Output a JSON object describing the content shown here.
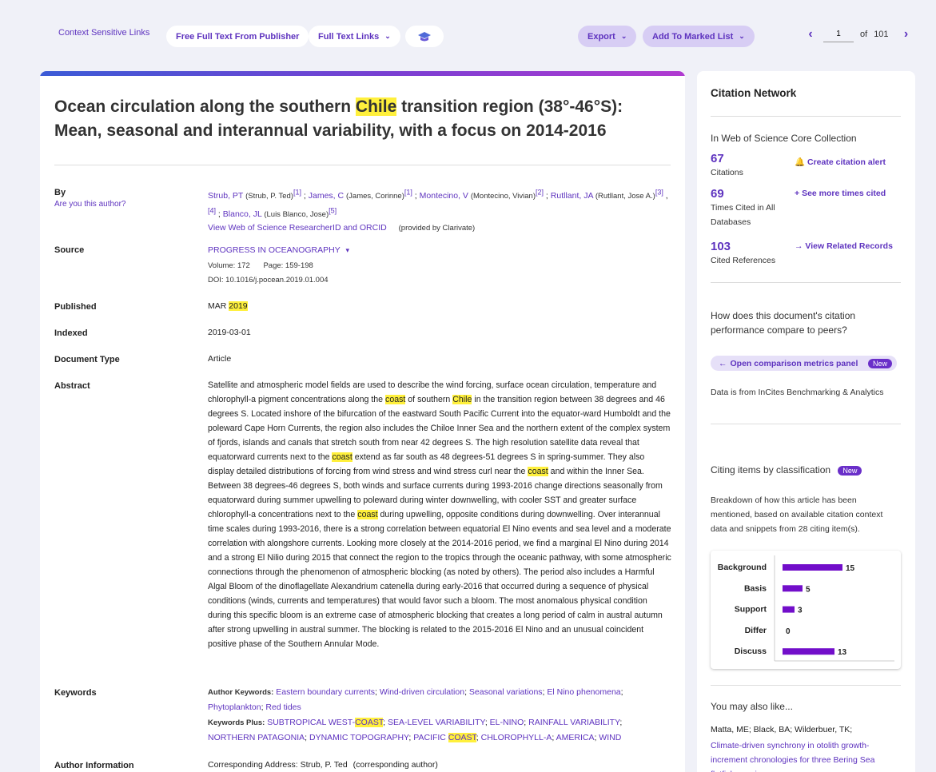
{
  "toolbar": {
    "context_links": "Context Sensitive Links",
    "free_full_text": "Free Full Text From Publisher",
    "full_text_links": "Full Text Links",
    "export": "Export",
    "add_marked": "Add To Marked List",
    "page_current": "1",
    "page_of": "of",
    "page_total": "101"
  },
  "record": {
    "title_pre": "Ocean circulation along the southern ",
    "title_hl": "Chile",
    "title_post": " transition region (38°-46°S): Mean, seasonal and interannual variability, with a focus on 2014-2016",
    "by_label": "By",
    "are_you": "Are you this author?",
    "authors": [
      {
        "name": "Strub, PT",
        "full": "(Strub, P. Ted)",
        "refs": [
          "[1]"
        ]
      },
      {
        "name": "James, C",
        "full": "(James, Corinne)",
        "refs": [
          "[1]"
        ]
      },
      {
        "name": "Montecino, V",
        "full": "(Montecino, Vivian)",
        "refs": [
          "[2]"
        ]
      },
      {
        "name": "Rutllant, JA",
        "full": "(Rutllant, Jose A.)",
        "refs": [
          "[3]",
          "[4]"
        ]
      },
      {
        "name": "Blanco, JL",
        "full": "(Luis Blanco, Jose)",
        "refs": [
          "[5]"
        ]
      }
    ],
    "researcher_link": "View Web of Science ResearcherID and ORCID",
    "provided_by": "(provided by Clarivate)",
    "source_label": "Source",
    "source": "PROGRESS IN OCEANOGRAPHY",
    "volume": "Volume: 172",
    "pages": "Page: 159-198",
    "doi": "DOI: 10.1016/j.pocean.2019.01.004",
    "published_label": "Published",
    "published_month": "MAR",
    "published_year": "2019",
    "indexed_label": "Indexed",
    "indexed": "2019-03-01",
    "doctype_label": "Document Type",
    "doctype": "Article",
    "abstract_label": "Abstract",
    "abstract": [
      {
        "t": "Satellite and atmospheric model fields are used to describe the wind forcing, surface ocean circulation, temperature and chlorophyll-a pigment concentrations along the "
      },
      {
        "t": "coast",
        "h": true
      },
      {
        "t": " of southern "
      },
      {
        "t": "Chile",
        "h": true
      },
      {
        "t": " in the transition region between 38 degrees and 46 degrees S. Located inshore of the bifurcation of the eastward South Pacific Current into the equator-ward Humboldt and the poleward Cape Horn Currents, the region also includes the Chiloe Inner Sea and the northern extent of the complex system of fjords, islands and canals that stretch south from near 42 degrees S. The high resolution satellite data reveal that equatorward currents next to the "
      },
      {
        "t": "coast",
        "h": true
      },
      {
        "t": " extend as far south as 48 degrees-51 degrees S in spring-summer. They also display detailed distributions of forcing from wind stress and wind stress curl near the "
      },
      {
        "t": "coast",
        "h": true
      },
      {
        "t": " and within the Inner Sea. Between 38 degrees-46 degrees S, both winds and surface currents during 1993-2016 change directions seasonally from equatorward during summer upwelling to poleward during winter downwelling, with cooler SST and greater surface chlorophyll-a concentrations next to the "
      },
      {
        "t": "coast",
        "h": true
      },
      {
        "t": " during upwelling, opposite conditions during downwelling. Over interannual time scales during 1993-2016, there is a strong correlation between equatorial El Nino events and sea level and a moderate correlation with alongshore currents. Looking more closely at the 2014-2016 period, we find a marginal El Nino during 2014 and a strong El Nilio during 2015 that connect the region to the tropics through the oceanic pathway, with some atmospheric connections through the phenomenon of atmospheric blocking (as noted by others). The period also includes a Harmful Algal Bloom of the dinoflagellate Alexandrium catenella during early-2016 that occurred during a sequence of physical conditions (winds, currents and temperatures) that would favor such a bloom. The most anomalous physical condition during this specific bloom is an extreme case of atmospheric blocking that creates a long period of calm in austral autumn after strong upwelling in austral summer. The blocking is related to the 2015-2016 El Nino and an unusual coincident positive phase of the Southern Annular Mode."
      }
    ],
    "keywords_label": "Keywords",
    "author_kw_label": "Author Keywords:",
    "author_keywords": [
      "Eastern boundary currents",
      "Wind-driven circulation",
      "Seasonal variations",
      "El Nino phenomena",
      "Phytoplankton",
      "Red tides"
    ],
    "kw_plus_label": "Keywords Plus:",
    "keywords_plus": [
      [
        {
          "t": "SUBTROPICAL WEST-"
        },
        {
          "t": "COAST",
          "h": true
        }
      ],
      [
        {
          "t": "SEA-LEVEL VARIABILITY"
        }
      ],
      [
        {
          "t": "EL-NINO"
        }
      ],
      [
        {
          "t": "RAINFALL VARIABILITY"
        }
      ],
      [
        {
          "t": "NORTHERN PATAGONIA"
        }
      ],
      [
        {
          "t": "DYNAMIC TOPOGRAPHY"
        }
      ],
      [
        {
          "t": "PACIFIC "
        },
        {
          "t": "COAST",
          "h": true
        }
      ],
      [
        {
          "t": "CHLOROPHYLL-A"
        }
      ],
      [
        {
          "t": "AMERICA"
        }
      ],
      [
        {
          "t": "WIND"
        }
      ]
    ],
    "author_info_label": "Author Information",
    "corresponding": "Corresponding Address: Strub, P. Ted",
    "corresponding_role": "(corresponding author)"
  },
  "side": {
    "citation_network": "Citation Network",
    "core_collection": "In Web of Science Core Collection",
    "citations_num": "67",
    "citations_label": "Citations",
    "create_alert": "Create citation alert",
    "times_cited_num": "69",
    "times_cited_label": "Times Cited in All Databases",
    "see_more": "See more times cited",
    "cited_refs_num": "103",
    "cited_refs_label": "Cited References",
    "related": "View Related Records",
    "compare_q": "How does this document's citation performance compare to peers?",
    "open_panel": "Open comparison metrics panel",
    "new_badge": "New",
    "incites": "Data is from InCites Benchmarking & Analytics",
    "citing_class": "Citing items by classification",
    "breakdown": "Breakdown of how this article has been mentioned, based on available citation context data and snippets from 28 citing item(s).",
    "may_like": "You may also like...",
    "like_authors": "Matta, ME; Black, BA; Wilderbuer, TK;",
    "like_title": "Climate-driven synchrony in otolith growth-increment chronologies for three Bering Sea flatfish species"
  },
  "chart_data": {
    "type": "bar",
    "orientation": "horizontal",
    "categories": [
      "Background",
      "Basis",
      "Support",
      "Differ",
      "Discuss"
    ],
    "values": [
      15,
      5,
      3,
      0,
      13
    ],
    "title": "",
    "xlabel": "",
    "ylabel": "",
    "bar_color": "#720eca",
    "grid": false,
    "data_labels": true
  }
}
